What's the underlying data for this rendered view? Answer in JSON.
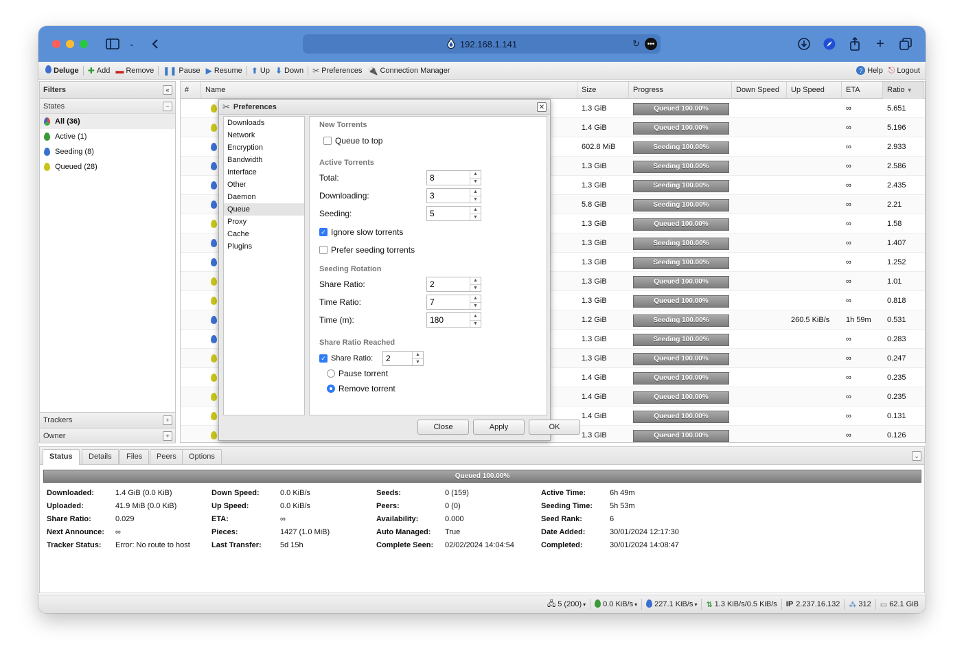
{
  "browser": {
    "url": "192.168.1.141"
  },
  "toolbar": {
    "app": "Deluge",
    "add": "Add",
    "remove": "Remove",
    "pause": "Pause",
    "resume": "Resume",
    "up": "Up",
    "down": "Down",
    "preferences": "Preferences",
    "connection_manager": "Connection Manager",
    "help": "Help",
    "logout": "Logout"
  },
  "filters": {
    "title": "Filters",
    "states_label": "States",
    "states": [
      {
        "label": "All (36)",
        "icon": "all"
      },
      {
        "label": "Active (1)",
        "icon": "green"
      },
      {
        "label": "Seeding (8)",
        "icon": "blue"
      },
      {
        "label": "Queued (28)",
        "icon": "yellow"
      }
    ],
    "trackers": "Trackers",
    "owner": "Owner"
  },
  "grid": {
    "columns": [
      "#",
      "Name",
      "Size",
      "Progress",
      "Down Speed",
      "Up Speed",
      "ETA",
      "Ratio"
    ],
    "rows": [
      {
        "state": "yellow",
        "size": "1.3 GiB",
        "progress": "Queued 100.00%",
        "down": "",
        "up": "",
        "eta": "∞",
        "ratio": "5.651"
      },
      {
        "state": "yellow",
        "size": "1.4 GiB",
        "progress": "Queued 100.00%",
        "down": "",
        "up": "",
        "eta": "∞",
        "ratio": "5.196"
      },
      {
        "state": "blue",
        "size": "602.8 MiB",
        "progress": "Seeding 100.00%",
        "down": "",
        "up": "",
        "eta": "∞",
        "ratio": "2.933"
      },
      {
        "state": "blue",
        "size": "1.3 GiB",
        "progress": "Seeding 100.00%",
        "down": "",
        "up": "",
        "eta": "∞",
        "ratio": "2.586"
      },
      {
        "state": "blue",
        "size": "1.3 GiB",
        "progress": "Seeding 100.00%",
        "down": "",
        "up": "",
        "eta": "∞",
        "ratio": "2.435"
      },
      {
        "state": "blue",
        "size": "5.8 GiB",
        "progress": "Seeding 100.00%",
        "down": "",
        "up": "",
        "eta": "∞",
        "ratio": "2.21"
      },
      {
        "state": "yellow",
        "size": "1.3 GiB",
        "progress": "Queued 100.00%",
        "down": "",
        "up": "",
        "eta": "∞",
        "ratio": "1.58"
      },
      {
        "state": "blue",
        "size": "1.3 GiB",
        "progress": "Seeding 100.00%",
        "down": "",
        "up": "",
        "eta": "∞",
        "ratio": "1.407"
      },
      {
        "state": "blue",
        "size": "1.3 GiB",
        "progress": "Seeding 100.00%",
        "down": "",
        "up": "",
        "eta": "∞",
        "ratio": "1.252"
      },
      {
        "state": "yellow",
        "size": "1.3 GiB",
        "progress": "Queued 100.00%",
        "down": "",
        "up": "",
        "eta": "∞",
        "ratio": "1.01"
      },
      {
        "state": "yellow",
        "size": "1.3 GiB",
        "progress": "Queued 100.00%",
        "down": "",
        "up": "",
        "eta": "∞",
        "ratio": "0.818"
      },
      {
        "state": "blue",
        "size": "1.2 GiB",
        "progress": "Seeding 100.00%",
        "down": "",
        "up": "260.5 KiB/s",
        "eta": "1h 59m",
        "ratio": "0.531"
      },
      {
        "state": "blue",
        "size": "1.3 GiB",
        "progress": "Seeding 100.00%",
        "down": "",
        "up": "",
        "eta": "∞",
        "ratio": "0.283"
      },
      {
        "state": "yellow",
        "size": "1.3 GiB",
        "progress": "Queued 100.00%",
        "down": "",
        "up": "",
        "eta": "∞",
        "ratio": "0.247"
      },
      {
        "state": "yellow",
        "size": "1.4 GiB",
        "progress": "Queued 100.00%",
        "down": "",
        "up": "",
        "eta": "∞",
        "ratio": "0.235"
      },
      {
        "state": "yellow",
        "size": "1.4 GiB",
        "progress": "Queued 100.00%",
        "down": "",
        "up": "",
        "eta": "∞",
        "ratio": "0.235"
      },
      {
        "state": "yellow",
        "size": "1.4 GiB",
        "progress": "Queued 100.00%",
        "down": "",
        "up": "",
        "eta": "∞",
        "ratio": "0.131"
      },
      {
        "state": "yellow",
        "size": "1.3 GiB",
        "progress": "Queued 100.00%",
        "down": "",
        "up": "",
        "eta": "∞",
        "ratio": "0.126"
      }
    ]
  },
  "prefs": {
    "title": "Preferences",
    "categories": [
      "Downloads",
      "Network",
      "Encryption",
      "Bandwidth",
      "Interface",
      "Other",
      "Daemon",
      "Queue",
      "Proxy",
      "Cache",
      "Plugins"
    ],
    "new_torrents": "New Torrents",
    "queue_to_top": "Queue to top",
    "active_torrents": "Active Torrents",
    "total_label": "Total:",
    "total_value": "8",
    "downloading_label": "Downloading:",
    "downloading_value": "3",
    "seeding_label": "Seeding:",
    "seeding_value": "5",
    "ignore_slow": "Ignore slow torrents",
    "prefer_seeding": "Prefer seeding torrents",
    "seeding_rotation": "Seeding Rotation",
    "share_ratio_label": "Share Ratio:",
    "share_ratio_value": "2",
    "time_ratio_label": "Time Ratio:",
    "time_ratio_value": "7",
    "time_m_label": "Time (m):",
    "time_m_value": "180",
    "share_ratio_reached": "Share Ratio Reached",
    "sr_check_label": "Share Ratio:",
    "sr_check_value": "2",
    "pause_torrent": "Pause torrent",
    "remove_torrent": "Remove torrent",
    "close": "Close",
    "apply": "Apply",
    "ok": "OK"
  },
  "details": {
    "tabs": [
      "Status",
      "Details",
      "Files",
      "Peers",
      "Options"
    ],
    "progress_text": "Queued 100.00%",
    "col1": [
      {
        "label": "Downloaded:",
        "value": "1.4 GiB (0.0 KiB)"
      },
      {
        "label": "Uploaded:",
        "value": "41.9 MiB (0.0 KiB)"
      },
      {
        "label": "Share Ratio:",
        "value": "0.029"
      },
      {
        "label": "Next Announce:",
        "value": "∞"
      },
      {
        "label": "Tracker Status:",
        "value": "Error: No route to host"
      }
    ],
    "col2": [
      {
        "label": "Down Speed:",
        "value": "0.0 KiB/s"
      },
      {
        "label": "Up Speed:",
        "value": "0.0 KiB/s"
      },
      {
        "label": "ETA:",
        "value": "∞"
      },
      {
        "label": "Pieces:",
        "value": "1427 (1.0 MiB)"
      },
      {
        "label": "Last Transfer:",
        "value": "5d 15h"
      }
    ],
    "col3": [
      {
        "label": "Seeds:",
        "value": "0 (159)"
      },
      {
        "label": "Peers:",
        "value": "0 (0)"
      },
      {
        "label": "Availability:",
        "value": "0.000"
      },
      {
        "label": "Auto Managed:",
        "value": "True"
      },
      {
        "label": "Complete Seen:",
        "value": "02/02/2024 14:04:54"
      }
    ],
    "col4": [
      {
        "label": "Active Time:",
        "value": "6h 49m"
      },
      {
        "label": "Seeding Time:",
        "value": "5h 53m"
      },
      {
        "label": "Seed Rank:",
        "value": "6"
      },
      {
        "label": "Date Added:",
        "value": "30/01/2024 12:17:30"
      },
      {
        "label": "Completed:",
        "value": "30/01/2024 14:08:47"
      }
    ]
  },
  "statusbar": {
    "connections": "5 (200)",
    "down_speed": "0.0 KiB/s",
    "up_speed": "227.1 KiB/s",
    "protocol": "1.3 KiB/s/0.5 KiB/s",
    "ip_label": "IP",
    "ip": "2.237.16.132",
    "dht": "312",
    "free_space": "62.1 GiB"
  }
}
